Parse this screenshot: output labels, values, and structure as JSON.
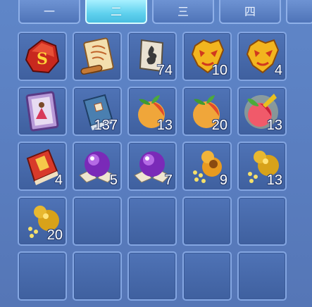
{
  "tabs": [
    {
      "label": "一"
    },
    {
      "label": "二",
      "active": true
    },
    {
      "label": "三"
    },
    {
      "label": "四"
    }
  ],
  "inventory": {
    "slots": [
      {
        "item": "red-rune-stone-icon",
        "qty": ""
      },
      {
        "item": "scroll-icon",
        "qty": ""
      },
      {
        "item": "fire-scroll-icon",
        "qty": "74"
      },
      {
        "item": "gold-mask-icon",
        "qty": "10"
      },
      {
        "item": "gold-mask-icon",
        "qty": "4"
      },
      {
        "item": "painting-icon",
        "qty": ""
      },
      {
        "item": "blue-book-icon",
        "qty": "137"
      },
      {
        "item": "peach-icon",
        "qty": "13"
      },
      {
        "item": "peach-icon",
        "qty": "20"
      },
      {
        "item": "glowing-peach-icon",
        "qty": "13"
      },
      {
        "item": "red-book-icon",
        "qty": "4"
      },
      {
        "item": "purple-orb-icon",
        "qty": "5"
      },
      {
        "item": "purple-orb-icon",
        "qty": "7"
      },
      {
        "item": "gourd-coins-icon",
        "qty": "9"
      },
      {
        "item": "gold-gourd-icon",
        "qty": "13"
      },
      {
        "item": "gold-gourd-icon",
        "qty": "20"
      },
      {
        "item": "",
        "qty": ""
      },
      {
        "item": "",
        "qty": ""
      },
      {
        "item": "",
        "qty": ""
      },
      {
        "item": "",
        "qty": ""
      },
      {
        "item": "",
        "qty": ""
      },
      {
        "item": "",
        "qty": ""
      },
      {
        "item": "",
        "qty": ""
      },
      {
        "item": "",
        "qty": ""
      },
      {
        "item": "",
        "qty": ""
      }
    ]
  }
}
